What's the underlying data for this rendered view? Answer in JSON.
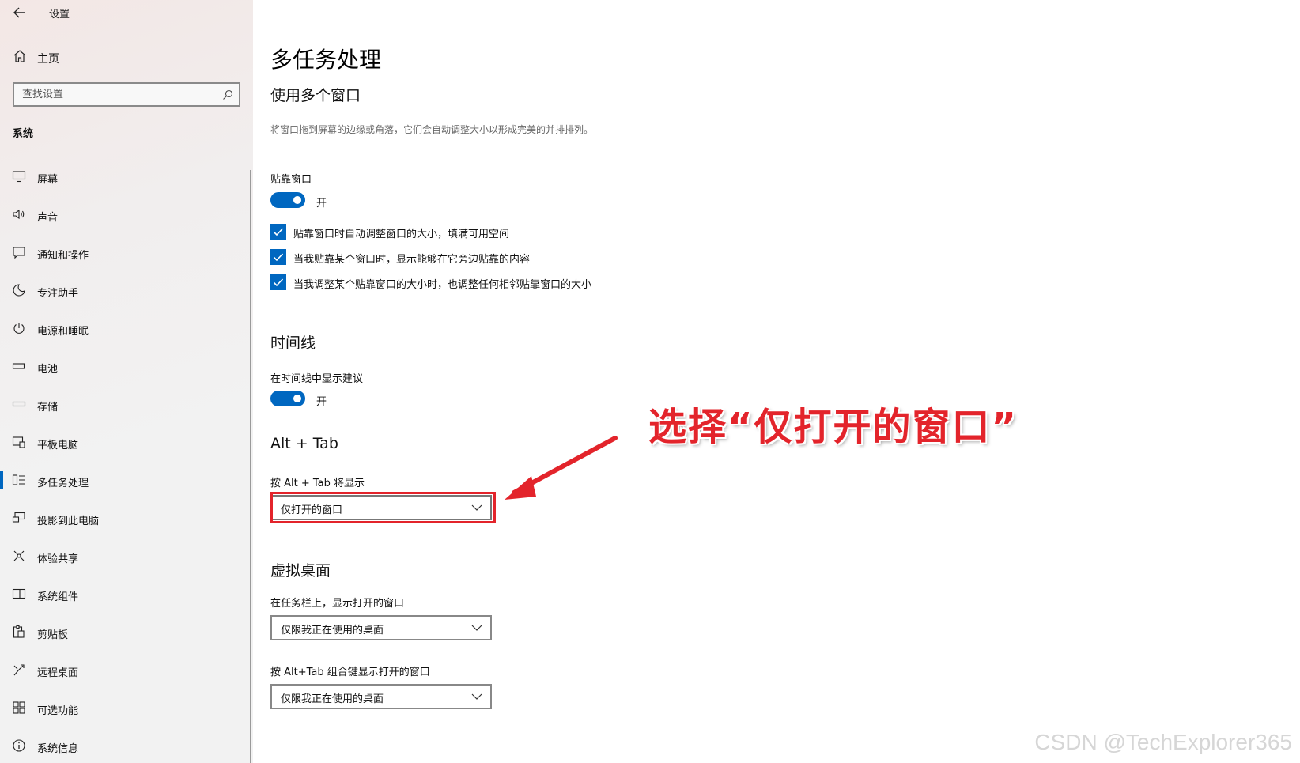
{
  "app": {
    "title": "设置"
  },
  "sidebar": {
    "home_label": "主页",
    "search_placeholder": "查找设置",
    "section_label": "系统",
    "items": [
      {
        "label": "屏幕",
        "icon": "monitor-icon"
      },
      {
        "label": "声音",
        "icon": "speaker-icon"
      },
      {
        "label": "通知和操作",
        "icon": "notification-icon"
      },
      {
        "label": "专注助手",
        "icon": "moon-icon"
      },
      {
        "label": "电源和睡眠",
        "icon": "power-icon"
      },
      {
        "label": "电池",
        "icon": "battery-icon"
      },
      {
        "label": "存储",
        "icon": "storage-icon"
      },
      {
        "label": "平板电脑",
        "icon": "tablet-icon"
      },
      {
        "label": "多任务处理",
        "icon": "multitasking-icon",
        "active": true
      },
      {
        "label": "投影到此电脑",
        "icon": "project-icon"
      },
      {
        "label": "体验共享",
        "icon": "share-icon"
      },
      {
        "label": "系统组件",
        "icon": "components-icon"
      },
      {
        "label": "剪贴板",
        "icon": "clipboard-icon"
      },
      {
        "label": "远程桌面",
        "icon": "remote-desktop-icon"
      },
      {
        "label": "可选功能",
        "icon": "optional-features-icon"
      },
      {
        "label": "系统信息",
        "icon": "info-icon"
      }
    ]
  },
  "main": {
    "title": "多任务处理",
    "snap": {
      "heading": "使用多个窗口",
      "description": "将窗口拖到屏幕的边缘或角落，它们会自动调整大小以形成完美的并排排列。",
      "toggle_label": "贴靠窗口",
      "toggle_state": "开",
      "options": [
        "贴靠窗口时自动调整窗口的大小，填满可用空间",
        "当我贴靠某个窗口时，显示能够在它旁边贴靠的内容",
        "当我调整某个贴靠窗口的大小时，也调整任何相邻贴靠窗口的大小"
      ]
    },
    "timeline": {
      "heading": "时间线",
      "toggle_label": "在时间线中显示建议",
      "toggle_state": "开"
    },
    "alttab": {
      "heading": "Alt + Tab",
      "label": "按 Alt + Tab 将显示",
      "value": "仅打开的窗口"
    },
    "virtual_desktops": {
      "heading": "虚拟桌面",
      "taskbar_label": "在任务栏上，显示打开的窗口",
      "taskbar_value": "仅限我正在使用的桌面",
      "alttab_label": "按 Alt+Tab 组合键显示打开的窗口",
      "alttab_value": "仅限我正在使用的桌面"
    }
  },
  "annotation": {
    "text": "选择“仅打开的窗口”",
    "color": "#e3242b"
  },
  "watermark": "CSDN @TechExplorer365",
  "colors": {
    "accent": "#0067c0",
    "annotation": "#e3242b"
  }
}
